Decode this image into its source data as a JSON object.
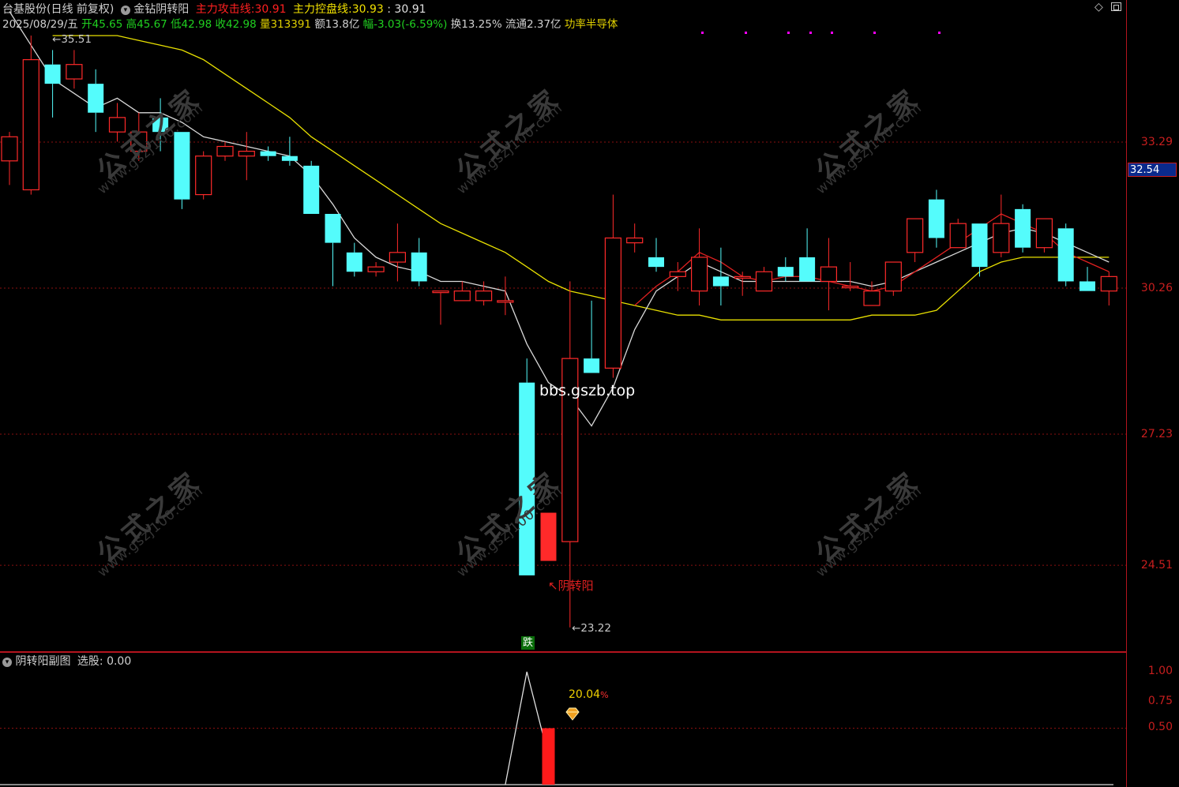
{
  "header": {
    "stock_name": "台基股份",
    "period": "(日线 前复权)",
    "indicator_name": "金钻阴转阳",
    "attack_label": "主力攻击线:",
    "attack_value": "30.91",
    "control_label": "主力控盘线:",
    "control_value": "30.93",
    "control_value2": ": 30.91",
    "date": "2025/08/29/五",
    "open": "开45.65",
    "high": "高45.67",
    "low": "低42.98",
    "close": "收42.98",
    "volume": "量313391",
    "amount": "额13.8亿",
    "change": "幅-3.03(-6.59%)",
    "turnover": "换13.25%",
    "float_cap": "流通2.37亿",
    "sector": "功率半导体"
  },
  "top_right_icons": [
    "diamond-icon",
    "window-restore-icon"
  ],
  "price_axis": {
    "labels": [
      "33.29",
      "30.26",
      "27.23",
      "24.51"
    ],
    "cursor_price": "32.54"
  },
  "annotations": {
    "high_mark": "35.51",
    "low_mark": "23.22",
    "signal_label": "阴转阳",
    "site_watermark": "bbs.gszb.top",
    "drop_badge": "跌"
  },
  "watermark": {
    "cn": "公式之家",
    "url": "www.gszj100.com"
  },
  "sub_panel": {
    "title": "阴转阳副图",
    "select_label": "选股: 0.00",
    "axis_labels": [
      "1.00",
      "0.75",
      "0.50"
    ],
    "bar_label": "20.04",
    "bar_label_suffix": "%"
  },
  "colors": {
    "up": "#ff2a2a",
    "down": "#54fcfc",
    "ma_white": "#d8d8d8",
    "ma_yellow": "#e8e000",
    "attack_red": "#e02020",
    "grid": "#8a1010",
    "magenta_dots": "#ff00ff"
  },
  "chart_data": [
    {
      "type": "candlestick",
      "title": "",
      "y_ticks": [
        33.29,
        30.26,
        27.23,
        24.51
      ],
      "ylim": [
        22.4,
        36.4
      ],
      "candles": [
        {
          "o": 32.9,
          "h": 33.5,
          "l": 32.4,
          "c": 33.4
        },
        {
          "o": 32.3,
          "h": 35.5,
          "l": 32.2,
          "c": 35.0
        },
        {
          "o": 34.9,
          "h": 35.2,
          "l": 33.8,
          "c": 34.5
        },
        {
          "o": 34.6,
          "h": 35.2,
          "l": 34.4,
          "c": 34.9
        },
        {
          "o": 34.5,
          "h": 34.8,
          "l": 33.5,
          "c": 33.9
        },
        {
          "o": 33.5,
          "h": 34.1,
          "l": 33.3,
          "c": 33.8
        },
        {
          "o": 33.1,
          "h": 33.9,
          "l": 32.9,
          "c": 33.5
        },
        {
          "o": 33.8,
          "h": 34.2,
          "l": 33.1,
          "c": 33.5
        },
        {
          "o": 33.5,
          "h": 33.5,
          "l": 31.9,
          "c": 32.1
        },
        {
          "o": 32.2,
          "h": 33.1,
          "l": 32.1,
          "c": 33.0
        },
        {
          "o": 33.0,
          "h": 33.3,
          "l": 32.9,
          "c": 33.2
        },
        {
          "o": 33.0,
          "h": 33.5,
          "l": 32.5,
          "c": 33.1
        },
        {
          "o": 33.1,
          "h": 33.2,
          "l": 32.9,
          "c": 33.0
        },
        {
          "o": 33.0,
          "h": 33.4,
          "l": 32.8,
          "c": 32.9
        },
        {
          "o": 32.8,
          "h": 32.9,
          "l": 31.8,
          "c": 31.8
        },
        {
          "o": 31.8,
          "h": 31.8,
          "l": 30.3,
          "c": 31.2
        },
        {
          "o": 31.0,
          "h": 31.2,
          "l": 30.5,
          "c": 30.6
        },
        {
          "o": 30.6,
          "h": 30.8,
          "l": 30.5,
          "c": 30.7
        },
        {
          "o": 30.8,
          "h": 31.6,
          "l": 30.4,
          "c": 31.0
        },
        {
          "o": 31.0,
          "h": 31.3,
          "l": 30.3,
          "c": 30.4
        },
        {
          "o": 30.2,
          "h": 30.2,
          "l": 29.5,
          "c": 30.2
        },
        {
          "o": 30.0,
          "h": 30.4,
          "l": 30.0,
          "c": 30.2
        },
        {
          "o": 30.0,
          "h": 30.4,
          "l": 29.9,
          "c": 30.2
        },
        {
          "o": 30.0,
          "h": 30.5,
          "l": 29.7,
          "c": 30.0
        },
        {
          "o": 28.3,
          "h": 28.8,
          "l": 24.3,
          "c": 24.3
        },
        {
          "o": 24.6,
          "h": 25.6,
          "l": 24.6,
          "c": 25.6
        },
        {
          "o": 25.0,
          "h": 30.4,
          "l": 23.22,
          "c": 28.8
        },
        {
          "o": 28.8,
          "h": 30.0,
          "l": 28.5,
          "c": 28.5
        },
        {
          "o": 28.6,
          "h": 32.2,
          "l": 28.4,
          "c": 31.3
        },
        {
          "o": 31.2,
          "h": 31.6,
          "l": 31.0,
          "c": 31.3
        },
        {
          "o": 30.9,
          "h": 31.3,
          "l": 30.6,
          "c": 30.7
        },
        {
          "o": 30.5,
          "h": 30.8,
          "l": 30.2,
          "c": 30.6
        },
        {
          "o": 30.2,
          "h": 31.5,
          "l": 29.9,
          "c": 30.9
        },
        {
          "o": 30.5,
          "h": 31.1,
          "l": 29.9,
          "c": 30.3
        },
        {
          "o": 30.5,
          "h": 30.6,
          "l": 30.1,
          "c": 30.5
        },
        {
          "o": 30.2,
          "h": 30.7,
          "l": 30.2,
          "c": 30.6
        },
        {
          "o": 30.7,
          "h": 30.9,
          "l": 30.4,
          "c": 30.5
        },
        {
          "o": 30.9,
          "h": 31.5,
          "l": 30.4,
          "c": 30.4
        },
        {
          "o": 30.4,
          "h": 31.3,
          "l": 29.8,
          "c": 30.7
        },
        {
          "o": 30.3,
          "h": 30.8,
          "l": 30.2,
          "c": 30.3
        },
        {
          "o": 29.9,
          "h": 30.4,
          "l": 29.9,
          "c": 30.2
        },
        {
          "o": 30.2,
          "h": 30.8,
          "l": 30.1,
          "c": 30.8
        },
        {
          "o": 31.0,
          "h": 31.7,
          "l": 30.8,
          "c": 31.7
        },
        {
          "o": 32.1,
          "h": 32.3,
          "l": 31.1,
          "c": 31.3
        },
        {
          "o": 31.1,
          "h": 31.7,
          "l": 31.1,
          "c": 31.6
        },
        {
          "o": 31.6,
          "h": 31.6,
          "l": 30.5,
          "c": 30.7
        },
        {
          "o": 31.0,
          "h": 32.2,
          "l": 30.9,
          "c": 31.6
        },
        {
          "o": 31.9,
          "h": 32.0,
          "l": 31.0,
          "c": 31.1
        },
        {
          "o": 31.1,
          "h": 31.7,
          "l": 31.0,
          "c": 31.7
        },
        {
          "o": 31.5,
          "h": 31.6,
          "l": 30.3,
          "c": 30.4
        },
        {
          "o": 30.4,
          "h": 30.7,
          "l": 30.2,
          "c": 30.2
        },
        {
          "o": 30.2,
          "h": 30.6,
          "l": 29.9,
          "c": 30.5
        }
      ],
      "ma_white": [
        36.0,
        35.3,
        34.6,
        34.3,
        34.0,
        34.2,
        33.9,
        33.9,
        33.7,
        33.4,
        33.3,
        33.2,
        33.1,
        33.0,
        32.6,
        32.0,
        31.3,
        30.9,
        30.7,
        30.6,
        30.4,
        30.4,
        30.3,
        30.2,
        29.1,
        28.3,
        28.0,
        27.4,
        28.2,
        29.4,
        30.2,
        30.5,
        30.8,
        30.6,
        30.4,
        30.4,
        30.4,
        30.4,
        30.4,
        30.4,
        30.3,
        30.4,
        30.6,
        30.8,
        31.0,
        31.2,
        31.4,
        31.5,
        31.4,
        31.2,
        31.0,
        30.8
      ],
      "ma_yellow": [
        null,
        null,
        35.5,
        35.5,
        35.5,
        35.5,
        35.4,
        35.3,
        35.2,
        35.0,
        34.7,
        34.4,
        34.1,
        33.8,
        33.4,
        33.1,
        32.8,
        32.5,
        32.2,
        31.9,
        31.6,
        31.4,
        31.2,
        31.0,
        30.7,
        30.4,
        30.2,
        30.1,
        30.0,
        29.9,
        29.8,
        29.7,
        29.7,
        29.6,
        29.6,
        29.6,
        29.6,
        29.6,
        29.6,
        29.6,
        29.7,
        29.7,
        29.7,
        29.8,
        30.2,
        30.6,
        30.8,
        30.9,
        30.9,
        30.9,
        30.9,
        30.9
      ],
      "attack_red": [
        null,
        null,
        null,
        null,
        null,
        null,
        null,
        null,
        null,
        null,
        null,
        null,
        null,
        null,
        null,
        null,
        null,
        null,
        null,
        null,
        null,
        null,
        null,
        null,
        null,
        null,
        null,
        null,
        null,
        29.9,
        30.3,
        30.6,
        31.0,
        30.8,
        30.5,
        30.4,
        30.5,
        30.5,
        30.4,
        30.3,
        30.2,
        30.3,
        30.6,
        30.9,
        31.2,
        31.5,
        31.8,
        31.6,
        31.4,
        31.0,
        30.8,
        30.6
      ]
    },
    {
      "type": "line",
      "title": "",
      "ylim": [
        0,
        1.0
      ],
      "y_ticks": [
        1.0,
        0.75,
        0.5
      ],
      "signal_line": {
        "x_index": [
          23,
          24,
          25
        ],
        "values": [
          0,
          1,
          0.25
        ]
      },
      "bar": {
        "x_index": 25,
        "value": 0.5
      }
    }
  ]
}
